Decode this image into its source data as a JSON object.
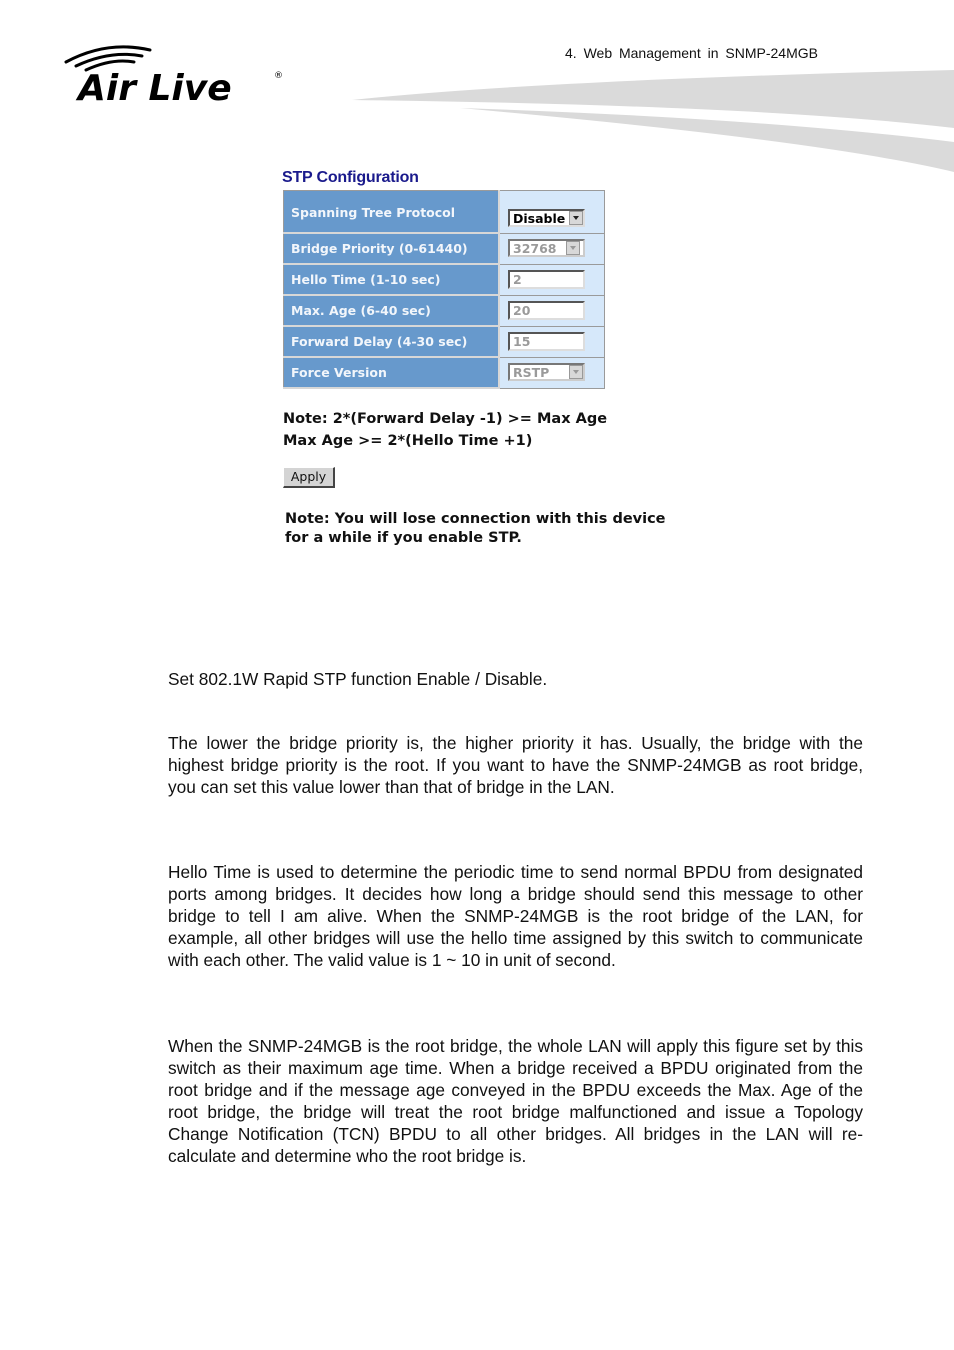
{
  "header": {
    "chapter_title": "4.   Web  Management  in  SNMP-24MGB",
    "logo_text": "Air Live",
    "logo_mark": "®"
  },
  "stp": {
    "title": "STP Configuration",
    "rows": [
      {
        "label": "Spanning Tree Protocol",
        "type": "select",
        "value": "Disable",
        "enabled": true
      },
      {
        "label": "Bridge Priority (0-61440)",
        "type": "select",
        "value": "32768",
        "enabled": false
      },
      {
        "label": "Hello Time (1-10 sec)",
        "type": "text",
        "value": "2",
        "enabled": false
      },
      {
        "label": "Max. Age (6-40 sec)",
        "type": "text",
        "value": "20",
        "enabled": false
      },
      {
        "label": "Forward Delay (4-30 sec)",
        "type": "text",
        "value": "15",
        "enabled": false
      },
      {
        "label": "Force Version",
        "type": "select",
        "value": "RSTP",
        "enabled": false
      }
    ],
    "note_line1": "Note: 2*(Forward Delay -1) >= Max Age",
    "note_line2": "Max Age >= 2*(Hello Time +1)",
    "apply_label": "Apply",
    "warning_line1": "Note: You will lose connection with this device",
    "warning_line2": "for a while if you enable STP."
  },
  "body": {
    "paragraphs": [
      "Set 802.1W Rapid STP function Enable / Disable.",
      "The lower the bridge priority is, the higher priority it has. Usually, the bridge with the highest bridge priority is the root. If you want to have the SNMP-24MGB as root bridge, you can set this value lower than that of bridge in the LAN.",
      "Hello Time is used to determine the periodic time to send normal BPDU from designated ports among bridges. It decides how long a bridge should send this message to other bridge to tell I am alive. When the SNMP-24MGB is the root bridge of the LAN, for example, all other bridges will use the hello time assigned by this switch to communicate with each other. The valid value is 1 ~ 10 in unit of second.",
      "When the SNMP-24MGB is the root bridge, the whole LAN will apply this figure set by this switch as their maximum age time. When a bridge received a BPDU originated from the root bridge and if the message age conveyed in the BPDU exceeds the Max. Age of the root bridge, the bridge will treat the root bridge malfunctioned and issue a Topology Change Notification (TCN) BPDU to all other bridges. All bridges in the LAN will re-calculate and determine who the root bridge is."
    ]
  },
  "colors": {
    "label_cell": "#6799cc",
    "value_cell": "#d6e8fa",
    "title": "#1a1a8c",
    "swoosh": "#dadada"
  }
}
